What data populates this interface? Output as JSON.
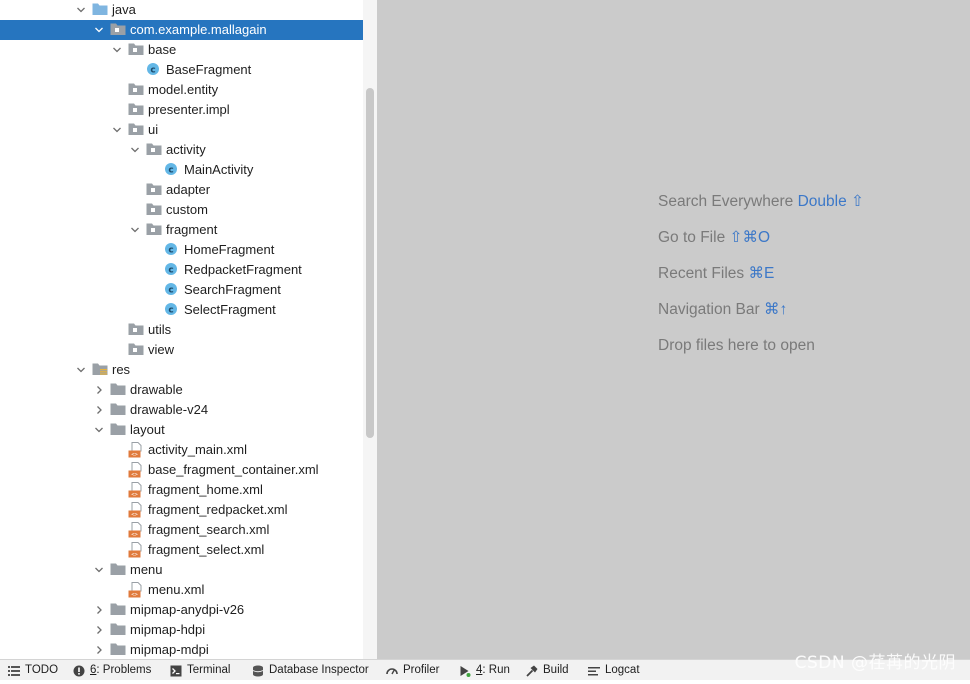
{
  "project_tree": {
    "rows": [
      {
        "label": "java",
        "depth": 0,
        "expanded": true,
        "icon": "source-folder-icon"
      },
      {
        "label": "com.example.mallagain",
        "depth": 1,
        "expanded": true,
        "icon": "package-icon",
        "selected": true
      },
      {
        "label": "base",
        "depth": 2,
        "expanded": true,
        "icon": "package-icon"
      },
      {
        "label": "BaseFragment",
        "depth": 3,
        "icon": "java-class-icon"
      },
      {
        "label": "model.entity",
        "depth": 2,
        "icon": "package-icon"
      },
      {
        "label": "presenter.impl",
        "depth": 2,
        "icon": "package-icon"
      },
      {
        "label": "ui",
        "depth": 2,
        "expanded": true,
        "icon": "package-icon"
      },
      {
        "label": "activity",
        "depth": 3,
        "expanded": true,
        "icon": "package-icon"
      },
      {
        "label": "MainActivity",
        "depth": 4,
        "icon": "java-class-icon"
      },
      {
        "label": "adapter",
        "depth": 3,
        "icon": "package-icon"
      },
      {
        "label": "custom",
        "depth": 3,
        "icon": "package-icon"
      },
      {
        "label": "fragment",
        "depth": 3,
        "expanded": true,
        "icon": "package-icon"
      },
      {
        "label": "HomeFragment",
        "depth": 4,
        "icon": "java-class-icon"
      },
      {
        "label": "RedpacketFragment",
        "depth": 4,
        "icon": "java-class-icon"
      },
      {
        "label": "SearchFragment",
        "depth": 4,
        "icon": "java-class-icon"
      },
      {
        "label": "SelectFragment",
        "depth": 4,
        "icon": "java-class-icon"
      },
      {
        "label": "utils",
        "depth": 2,
        "icon": "package-icon"
      },
      {
        "label": "view",
        "depth": 2,
        "icon": "package-icon"
      },
      {
        "label": "res",
        "depth": 0,
        "expanded": true,
        "icon": "resource-folder-icon"
      },
      {
        "label": "drawable",
        "depth": 1,
        "expanded": false,
        "icon": "folder-icon"
      },
      {
        "label": "drawable-v24",
        "depth": 1,
        "expanded": false,
        "icon": "folder-icon"
      },
      {
        "label": "layout",
        "depth": 1,
        "expanded": true,
        "icon": "folder-icon"
      },
      {
        "label": "activity_main.xml",
        "depth": 2,
        "icon": "xml-file-icon"
      },
      {
        "label": "base_fragment_container.xml",
        "depth": 2,
        "icon": "xml-file-icon"
      },
      {
        "label": "fragment_home.xml",
        "depth": 2,
        "icon": "xml-file-icon"
      },
      {
        "label": "fragment_redpacket.xml",
        "depth": 2,
        "icon": "xml-file-icon"
      },
      {
        "label": "fragment_search.xml",
        "depth": 2,
        "icon": "xml-file-icon"
      },
      {
        "label": "fragment_select.xml",
        "depth": 2,
        "icon": "xml-file-icon"
      },
      {
        "label": "menu",
        "depth": 1,
        "expanded": true,
        "icon": "folder-icon"
      },
      {
        "label": "menu.xml",
        "depth": 2,
        "icon": "xml-file-icon"
      },
      {
        "label": "mipmap-anydpi-v26",
        "depth": 1,
        "expanded": false,
        "icon": "folder-icon"
      },
      {
        "label": "mipmap-hdpi",
        "depth": 1,
        "expanded": false,
        "icon": "folder-icon"
      },
      {
        "label": "mipmap-mdpi",
        "depth": 1,
        "expanded": false,
        "icon": "folder-icon"
      }
    ]
  },
  "editor_hints": {
    "search_everywhere": {
      "text": "Search Everywhere",
      "shortcut": "Double ⇧"
    },
    "go_to_file": {
      "text": "Go to File",
      "shortcut": "⇧⌘O"
    },
    "recent_files": {
      "text": "Recent Files",
      "shortcut": "⌘E"
    },
    "navigation_bar": {
      "text": "Navigation Bar",
      "shortcut": "⌘↑"
    },
    "drop_files": {
      "text": "Drop files here to open"
    }
  },
  "tool_windows": {
    "todo": {
      "label": "TODO",
      "icon": "list-icon"
    },
    "problems": {
      "number": "6",
      "label": ": Problems",
      "icon": "warning-circle-icon"
    },
    "terminal": {
      "label": "Terminal",
      "icon": "terminal-icon"
    },
    "database_inspector": {
      "label": "Database Inspector",
      "icon": "database-icon"
    },
    "profiler": {
      "label": "Profiler",
      "icon": "profiler-gauge-icon"
    },
    "run": {
      "number": "4",
      "label": ": Run",
      "icon": "run-icon"
    },
    "build": {
      "label": "Build",
      "icon": "hammer-icon"
    },
    "logcat": {
      "label": "Logcat",
      "icon": "logcat-icon"
    }
  },
  "watermark": "CSDN @荏苒的光阴",
  "colors": {
    "selection": "#2675bf",
    "editor_background": "#cbcbcb",
    "hint_text": "#7a7a7a",
    "shortcut_text": "#3c78c8",
    "class_icon": "#63b7e6"
  }
}
